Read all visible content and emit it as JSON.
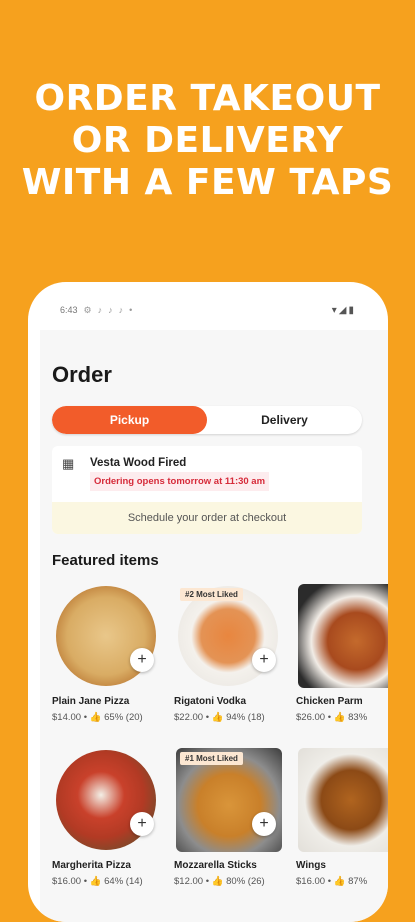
{
  "headline": [
    "ORDER TAKEOUT",
    "OR DELIVERY",
    "WITH A FEW TAPS"
  ],
  "status_bar": {
    "time": "6:43"
  },
  "page_title": "Order",
  "toggle": {
    "pickup": "Pickup",
    "delivery": "Delivery",
    "active": "pickup"
  },
  "store": {
    "name": "Vesta Wood Fired",
    "notice": "Ordering opens tomorrow at 11:30 am",
    "schedule": "Schedule your order at checkout"
  },
  "featured": {
    "title": "Featured items",
    "rows": [
      [
        {
          "name": "Plain Jane Pizza",
          "meta": "$14.00 • 👍 65% (20)",
          "badge": ""
        },
        {
          "name": "Rigatoni Vodka",
          "meta": "$22.00 • 👍 94% (18)",
          "badge": "#2 Most Liked"
        },
        {
          "name": "Chicken Parm",
          "meta": "$26.00 • 👍 83%",
          "badge": ""
        }
      ],
      [
        {
          "name": "Margherita Pizza",
          "meta": "$16.00 • 👍 64% (14)",
          "badge": ""
        },
        {
          "name": "Mozzarella Sticks",
          "meta": "$12.00 • 👍 80% (26)",
          "badge": "#1 Most Liked"
        },
        {
          "name": "Wings",
          "meta": "$16.00 • 👍 87%",
          "badge": ""
        }
      ]
    ]
  },
  "colors": {
    "background": "#F6A11E",
    "accent": "#F25C2A",
    "notice": "#D62B3A"
  }
}
